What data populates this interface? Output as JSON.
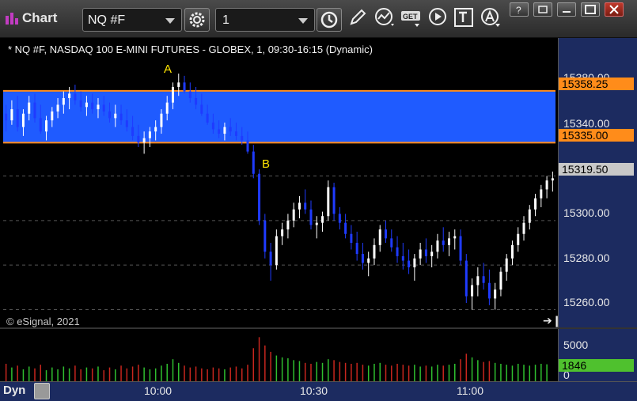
{
  "window": {
    "title": "Chart",
    "symbol": "NQ #F",
    "interval": "1"
  },
  "toolbar": {
    "icons": [
      "gear-icon",
      "clock-icon",
      "pencil-icon",
      "line-study-icon",
      "get-icon",
      "play-icon",
      "text-icon",
      "alert-icon"
    ],
    "window_buttons": [
      "help-icon",
      "restore-icon",
      "maximize-icon",
      "close-icon"
    ]
  },
  "chart": {
    "title": "* NQ #F, NASDAQ 100 E-MINI FUTURES - GLOBEX, 1, 09:30-16:15 (Dynamic)",
    "watermark": "© eSignal, 2021",
    "annotations": {
      "a": "A",
      "b": "B"
    },
    "price_axis": [
      "15380.00",
      "15340.00",
      "15300.00",
      "15280.00",
      "15260.00"
    ],
    "price_tags": {
      "upper": "15358.25",
      "lower": "15335.00",
      "last": "15319.50"
    },
    "volume_axis": {
      "top": "5000",
      "zero": "0",
      "last": "1846"
    },
    "time_axis": [
      "10:00",
      "10:30",
      "11:00"
    ],
    "dyn_label": "Dyn",
    "colors": {
      "zone_fill": "#1f5bff",
      "zone_border": "#ff8c1a",
      "up_candle": "#ffffff",
      "down_candle": "#1f3bff",
      "vol_up": "#2fbf2f",
      "vol_down": "#c8261e",
      "axis_bg": "#1c2b60"
    }
  },
  "chart_data": {
    "type": "candlestick",
    "symbol": "NQ #F",
    "ylim": [
      15252,
      15382
    ],
    "yticks": [
      15260,
      15280,
      15300,
      15320,
      15340
    ],
    "zone": [
      15335.0,
      15358.25
    ],
    "last_price": 15319.5,
    "volume_ylim": [
      0,
      5000
    ],
    "x_labels": [
      "10:00",
      "10:30",
      "11:00"
    ],
    "ohlc": [
      [
        15348,
        15352,
        15340,
        15345
      ],
      [
        15345,
        15354,
        15343,
        15350
      ],
      [
        15350,
        15356,
        15340,
        15342
      ],
      [
        15342,
        15350,
        15338,
        15348
      ],
      [
        15348,
        15356,
        15345,
        15353
      ],
      [
        15353,
        15357,
        15344,
        15346
      ],
      [
        15346,
        15352,
        15339,
        15340
      ],
      [
        15340,
        15347,
        15336,
        15345
      ],
      [
        15345,
        15351,
        15342,
        15349
      ],
      [
        15349,
        15355,
        15346,
        15352
      ],
      [
        15352,
        15358,
        15348,
        15355
      ],
      [
        15355,
        15360,
        15350,
        15357
      ],
      [
        15357,
        15361,
        15352,
        15354
      ],
      [
        15354,
        15358,
        15349,
        15351
      ],
      [
        15351,
        15356,
        15347,
        15353
      ],
      [
        15353,
        15357,
        15348,
        15350
      ],
      [
        15350,
        15355,
        15346,
        15352
      ],
      [
        15352,
        15356,
        15347,
        15349
      ],
      [
        15349,
        15353,
        15344,
        15346
      ],
      [
        15346,
        15352,
        15342,
        15348
      ],
      [
        15348,
        15352,
        15343,
        15345
      ],
      [
        15345,
        15350,
        15340,
        15342
      ],
      [
        15342,
        15347,
        15336,
        15338
      ],
      [
        15338,
        15343,
        15333,
        15335
      ],
      [
        15335,
        15340,
        15330,
        15337
      ],
      [
        15337,
        15342,
        15333,
        15340
      ],
      [
        15340,
        15345,
        15336,
        15342
      ],
      [
        15342,
        15350,
        15339,
        15348
      ],
      [
        15348,
        15356,
        15345,
        15353
      ],
      [
        15353,
        15362,
        15350,
        15360
      ],
      [
        15360,
        15366,
        15356,
        15362
      ],
      [
        15362,
        15365,
        15357,
        15358
      ],
      [
        15358,
        15362,
        15353,
        15355
      ],
      [
        15355,
        15360,
        15350,
        15352
      ],
      [
        15352,
        15357,
        15347,
        15348
      ],
      [
        15348,
        15352,
        15343,
        15344
      ],
      [
        15344,
        15348,
        15339,
        15341
      ],
      [
        15341,
        15345,
        15337,
        15339
      ],
      [
        15339,
        15344,
        15336,
        15342
      ],
      [
        15342,
        15346,
        15338,
        15340
      ],
      [
        15340,
        15344,
        15336,
        15338
      ],
      [
        15338,
        15342,
        15334,
        15336
      ],
      [
        15336,
        15340,
        15330,
        15331
      ],
      [
        15331,
        15334,
        15319,
        15321
      ],
      [
        15321,
        15323,
        15298,
        15300
      ],
      [
        15300,
        15303,
        15283,
        15286
      ],
      [
        15286,
        15290,
        15273,
        15280
      ],
      [
        15280,
        15296,
        15278,
        15293
      ],
      [
        15293,
        15299,
        15289,
        15296
      ],
      [
        15296,
        15303,
        15292,
        15300
      ],
      [
        15300,
        15308,
        15297,
        15305
      ],
      [
        15305,
        15311,
        15301,
        15308
      ],
      [
        15308,
        15314,
        15303,
        15305
      ],
      [
        15305,
        15309,
        15296,
        15298
      ],
      [
        15298,
        15302,
        15292,
        15299
      ],
      [
        15299,
        15304,
        15295,
        15302
      ],
      [
        15302,
        15318,
        15300,
        15315
      ],
      [
        15315,
        15317,
        15300,
        15303
      ],
      [
        15303,
        15306,
        15296,
        15299
      ],
      [
        15299,
        15303,
        15292,
        15294
      ],
      [
        15294,
        15298,
        15287,
        15290
      ],
      [
        15290,
        15295,
        15282,
        15285
      ],
      [
        15285,
        15290,
        15278,
        15281
      ],
      [
        15281,
        15286,
        15275,
        15283
      ],
      [
        15283,
        15292,
        15280,
        15289
      ],
      [
        15289,
        15298,
        15286,
        15296
      ],
      [
        15296,
        15300,
        15290,
        15292
      ],
      [
        15292,
        15296,
        15286,
        15288
      ],
      [
        15288,
        15293,
        15281,
        15284
      ],
      [
        15284,
        15290,
        15278,
        15282
      ],
      [
        15282,
        15287,
        15276,
        15279
      ],
      [
        15279,
        15285,
        15273,
        15283
      ],
      [
        15283,
        15290,
        15280,
        15287
      ],
      [
        15287,
        15292,
        15281,
        15284
      ],
      [
        15284,
        15289,
        15279,
        15286
      ],
      [
        15286,
        15294,
        15283,
        15291
      ],
      [
        15291,
        15297,
        15286,
        15289
      ],
      [
        15289,
        15295,
        15284,
        15292
      ],
      [
        15292,
        15296,
        15287,
        15293
      ],
      [
        15293,
        15296,
        15280,
        15282
      ],
      [
        15282,
        15285,
        15263,
        15266
      ],
      [
        15266,
        15274,
        15260,
        15271
      ],
      [
        15271,
        15279,
        15266,
        15275
      ],
      [
        15275,
        15281,
        15269,
        15272
      ],
      [
        15272,
        15278,
        15262,
        15265
      ],
      [
        15265,
        15272,
        15260,
        15269
      ],
      [
        15269,
        15279,
        15266,
        15277
      ],
      [
        15277,
        15285,
        15273,
        15283
      ],
      [
        15283,
        15291,
        15280,
        15289
      ],
      [
        15289,
        15297,
        15286,
        15294
      ],
      [
        15294,
        15302,
        15291,
        15299
      ],
      [
        15299,
        15307,
        15296,
        15305
      ],
      [
        15305,
        15312,
        15302,
        15310
      ],
      [
        15310,
        15316,
        15306,
        15314
      ],
      [
        15314,
        15320,
        15310,
        15318
      ],
      [
        15318,
        15322,
        15313,
        15319
      ]
    ],
    "volumes": [
      1900,
      1500,
      1700,
      1300,
      1600,
      1400,
      1800,
      1200,
      1500,
      1300,
      1600,
      1400,
      1700,
      1300,
      1500,
      1400,
      1600,
      1200,
      1500,
      1300,
      1700,
      1400,
      1600,
      1800,
      1500,
      1300,
      1400,
      1700,
      1900,
      2400,
      2000,
      1700,
      1500,
      1600,
      1400,
      1300,
      1500,
      1400,
      1300,
      1500,
      1600,
      1400,
      1800,
      3600,
      4800,
      3900,
      3200,
      2800,
      2600,
      2500,
      2300,
      2200,
      2000,
      1900,
      2100,
      2000,
      2400,
      2300,
      2100,
      2000,
      1900,
      2000,
      1800,
      1700,
      1900,
      2000,
      1800,
      1700,
      1900,
      1800,
      1700,
      1800,
      1600,
      1700,
      1600,
      1800,
      1700,
      1800,
      1900,
      2400,
      3000,
      2600,
      2300,
      2100,
      2200,
      2000,
      1900,
      1800,
      1700,
      1900,
      1800,
      1700,
      1800,
      1900,
      1846
    ]
  }
}
